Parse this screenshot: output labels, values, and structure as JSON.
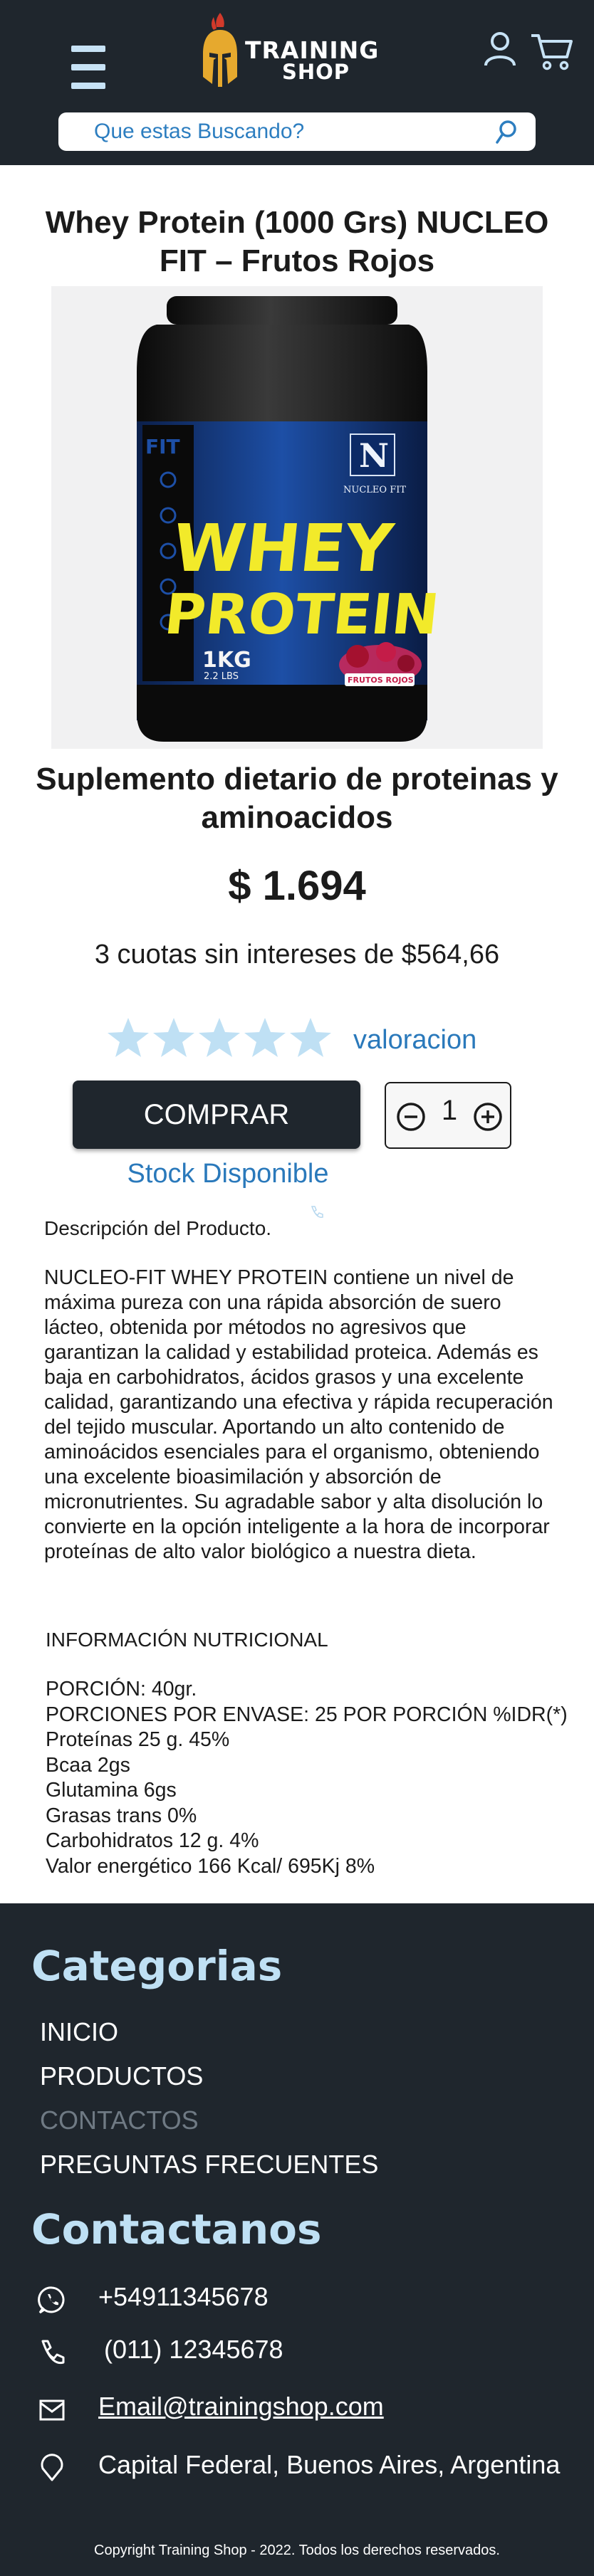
{
  "header": {
    "brand_line1": "TRAINING",
    "brand_line2": "SHOP",
    "search_placeholder": "Que estas Buscando?"
  },
  "product": {
    "title": "Whey Protein (1000 Grs) NUCLEO FIT – Frutos Rojos",
    "subtitle": "Suplemento dietario de proteinas y aminoacidos",
    "price": "$ 1.694",
    "installments": "3 cuotas sin intereses de $564,66",
    "rating_label": "valoracion",
    "rating_stars": 5,
    "buy_label": "COMPRAR",
    "quantity": "1",
    "stock": "Stock Disponible",
    "image": {
      "brand_fit": "FIT",
      "brand_logo_letter": "N",
      "brand_logo_text": "NUCLEO FIT",
      "product_line1": "WHEY",
      "product_line2": "PROTEIN",
      "weight": "1KG",
      "weight_lb": "2.2 LBS",
      "flavor": "FRUTOS ROJOS"
    }
  },
  "description": {
    "heading": "Descripción del Producto.",
    "body": "NUCLEO-FIT WHEY PROTEIN contiene un nivel de máxima pureza con una rápida absorción de suero lácteo, obtenida por métodos no agresivos que garantizan la calidad y estabilidad proteica. Además es baja en carbohidratos, ácidos grasos y una excelente calidad, garantizando una efectiva y rápida recuperación del tejido muscular. Aportando un alto contenido de aminoácidos esenciales para el organismo, obteniendo una excelente bioasimilación y absorción de micronutrientes. Su agradable sabor y alta disolución lo convierte en la opción inteligente a la hora de incorporar proteínas de alto valor biológico a nuestra dieta."
  },
  "nutrition": {
    "heading": "INFORMACIÓN NUTRICIONAL",
    "lines": [
      "PORCIÓN: 40gr.",
      "PORCIONES POR ENVASE: 25 POR PORCIÓN %IDR(*)",
      "Proteínas 25 g. 45%",
      "Bcaa 2gs",
      "Glutamina 6gs",
      "Grasas trans 0%",
      "Carbohidratos 12 g. 4%",
      "Valor energético 166 Kcal/ 695Kj 8%"
    ]
  },
  "footer": {
    "categories_heading": "Categorias",
    "categories": [
      "INICIO",
      "PRODUCTOS",
      "CONTACTOS",
      "PREGUNTAS FRECUENTES"
    ],
    "contact_heading": "Contactanos",
    "whatsapp": "+54911345678",
    "phone": "(011) 12345678",
    "email": "Email@trainingshop.com",
    "location": "Capital Federal, Buenos Aires, Argentina",
    "copyright": "Copyright Training Shop - 2022. Todos los derechos reservados."
  },
  "colors": {
    "dark": "#1f262d",
    "accent_blue": "#2a79bb",
    "star": "#bfe0f4",
    "heading_light": "#bfe0f4"
  }
}
